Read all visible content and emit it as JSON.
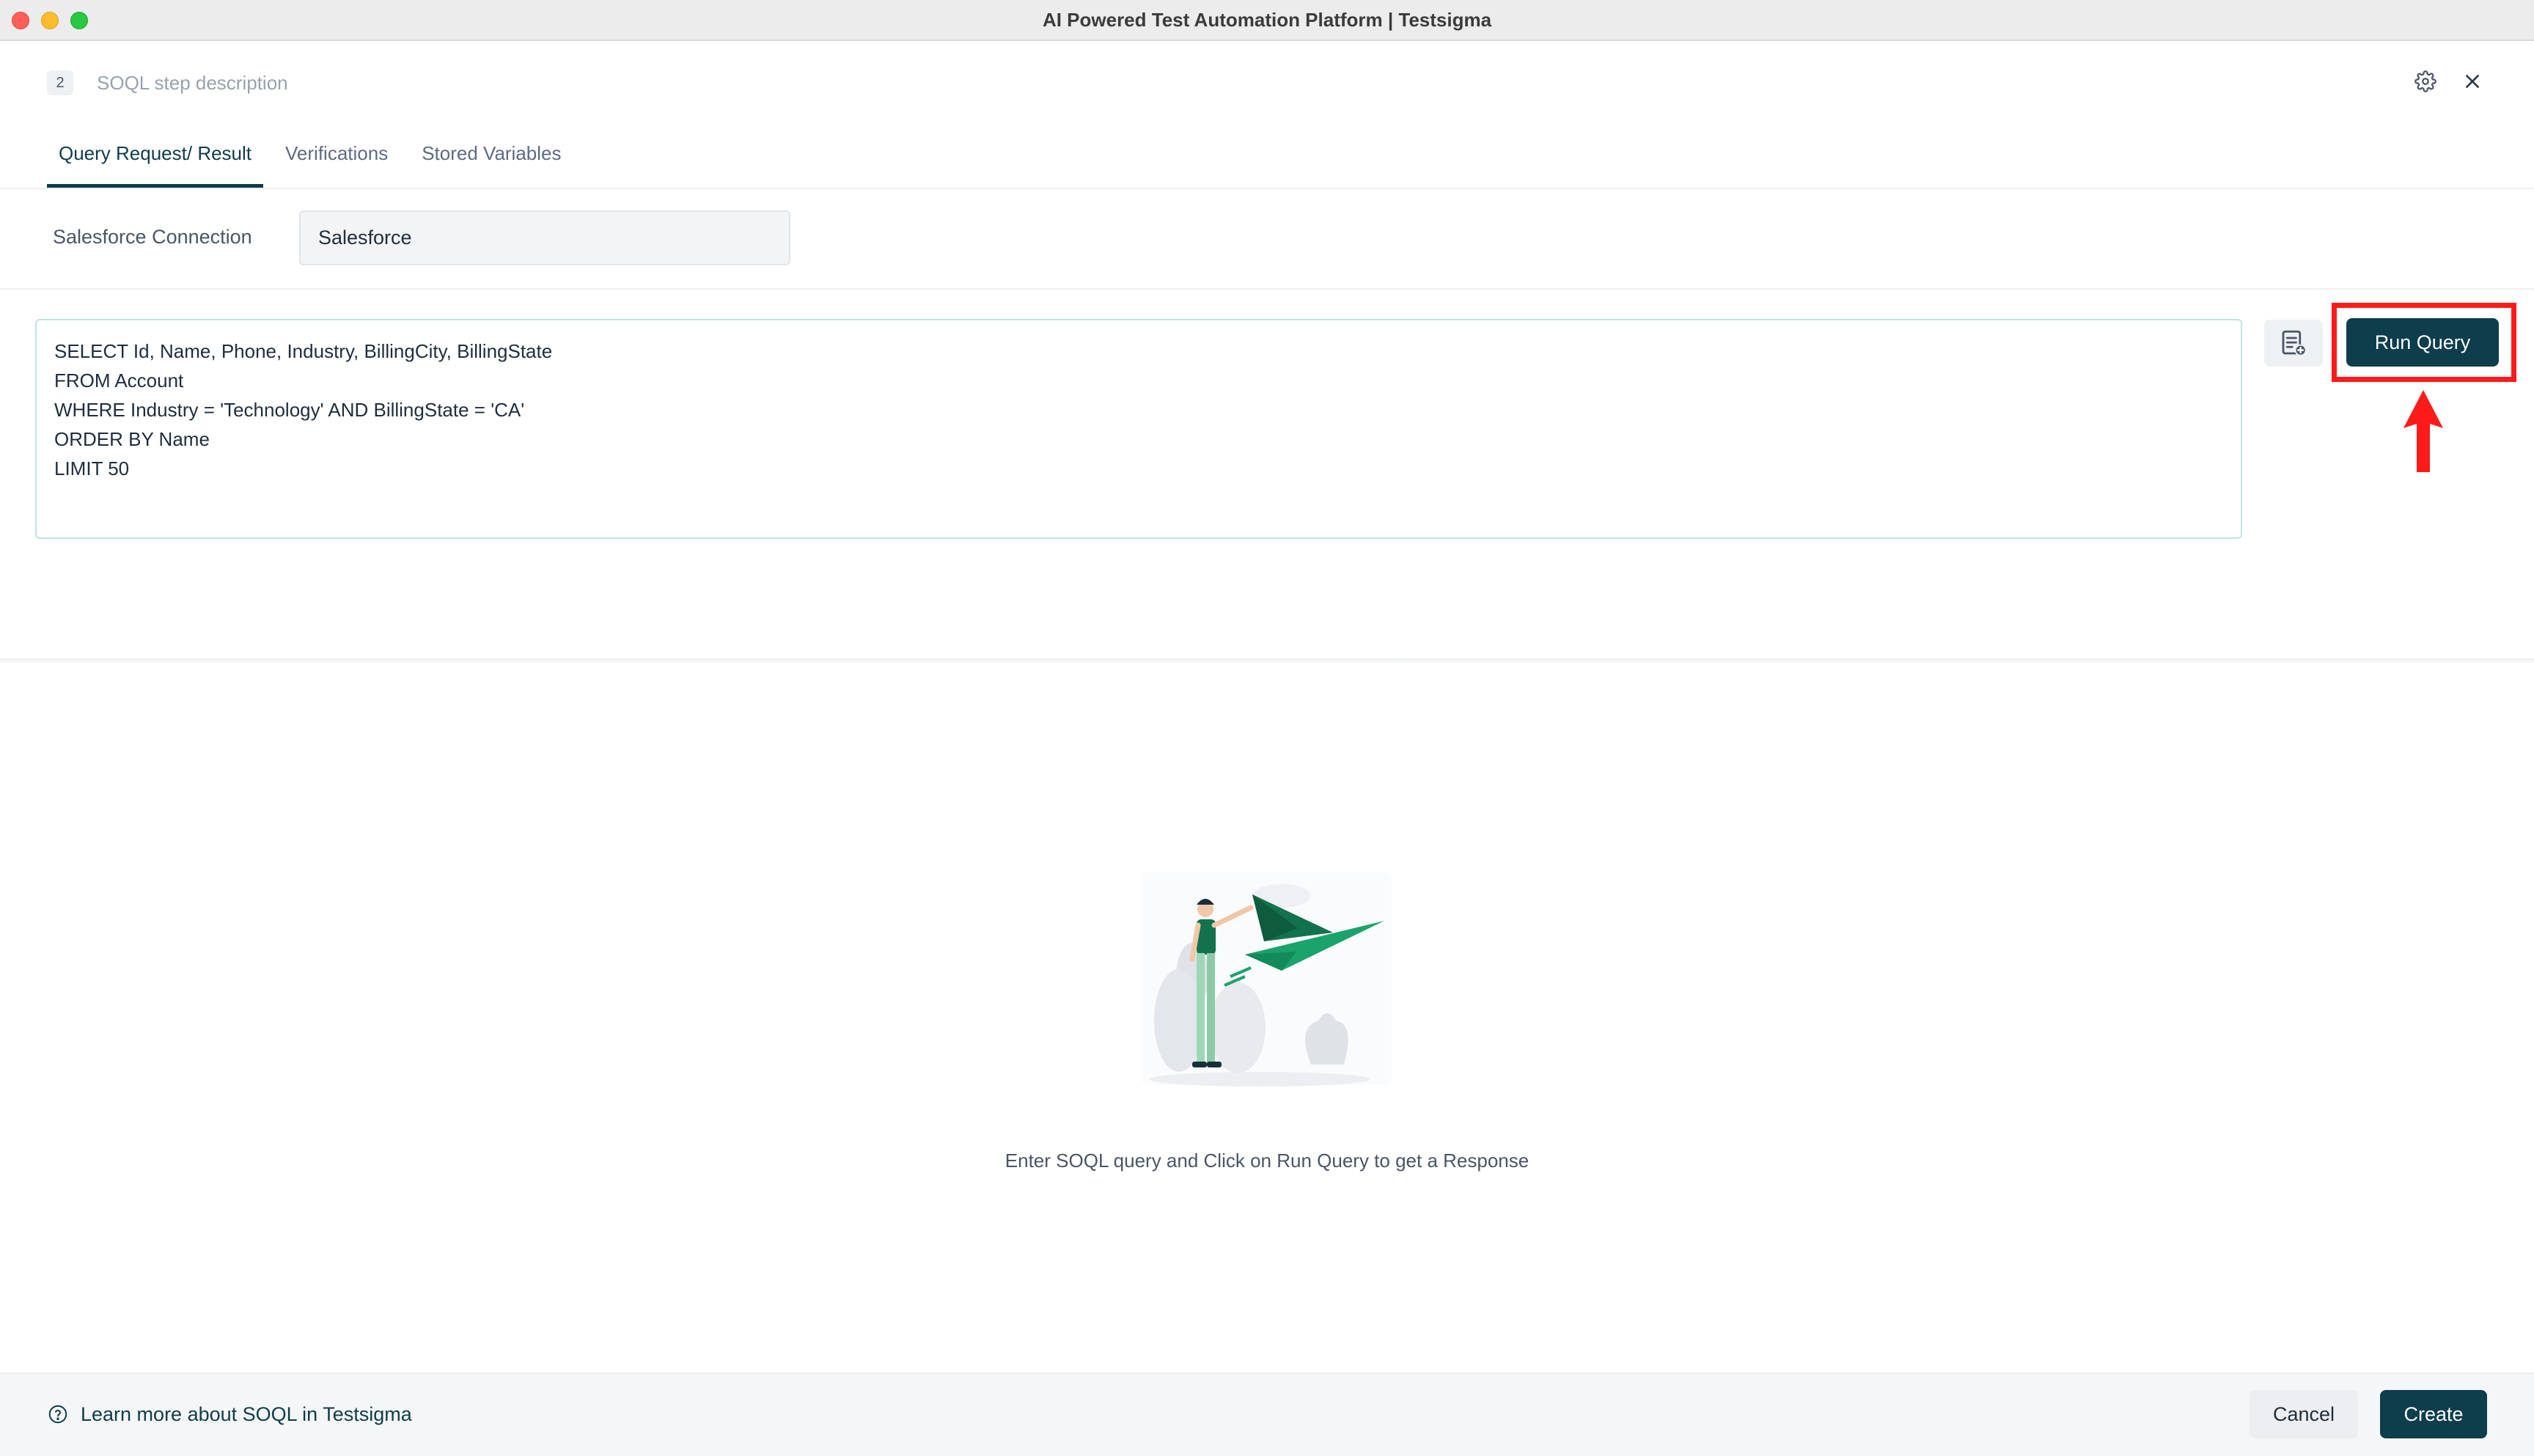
{
  "window": {
    "title": "AI Powered Test Automation Platform | Testsigma"
  },
  "step": {
    "number": "2",
    "description": "SOQL step description"
  },
  "tabs": [
    {
      "label": "Query Request/ Result",
      "active": true
    },
    {
      "label": "Verifications",
      "active": false
    },
    {
      "label": "Stored Variables",
      "active": false
    }
  ],
  "connection": {
    "label": "Salesforce Connection",
    "value": "Salesforce"
  },
  "query": {
    "lines": [
      "SELECT Id, Name, Phone, Industry, BillingCity, BillingState",
      "FROM Account",
      "WHERE Industry = 'Technology' AND BillingState = 'CA'",
      "ORDER BY Name",
      "LIMIT 50"
    ]
  },
  "run_button": {
    "label": "Run Query"
  },
  "empty_state": {
    "message": "Enter SOQL query and Click on Run Query to get a Response"
  },
  "footer": {
    "help_link": "Learn more about SOQL in Testsigma",
    "cancel_label": "Cancel",
    "create_label": "Create"
  },
  "colors": {
    "primary": "#0e3d4b",
    "highlight": "#ff1a1a",
    "illustration_green": "#1aa36b"
  },
  "icons": {
    "settings": "gear-icon",
    "close": "close-icon",
    "template": "query-template-icon",
    "help": "question-circle-icon",
    "annotation": "red-up-arrow-icon"
  }
}
